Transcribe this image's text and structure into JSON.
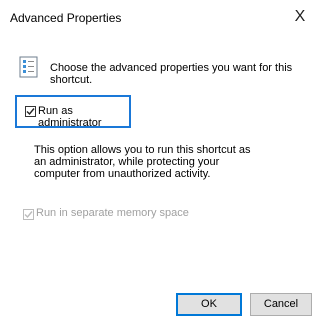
{
  "window": {
    "title": "Advanced Properties",
    "close_glyph": "X"
  },
  "header": {
    "icon": "shortcut-properties-icon",
    "text": "Choose the advanced properties you want for this shortcut."
  },
  "options": {
    "run_as_admin": {
      "label": "Run as administrator",
      "checked": true,
      "focused": true
    },
    "description": "This option allows you to run this shortcut as an administrator, while protecting your computer from unauthorized activity.",
    "separate_memory": {
      "label": "Run in separate memory space",
      "checked": true,
      "disabled": true
    }
  },
  "buttons": {
    "ok": "OK",
    "cancel": "Cancel"
  },
  "colors": {
    "focus": "#1a78d8",
    "disabled_text": "#a0a0a0",
    "button_face": "#e1e1e1"
  }
}
